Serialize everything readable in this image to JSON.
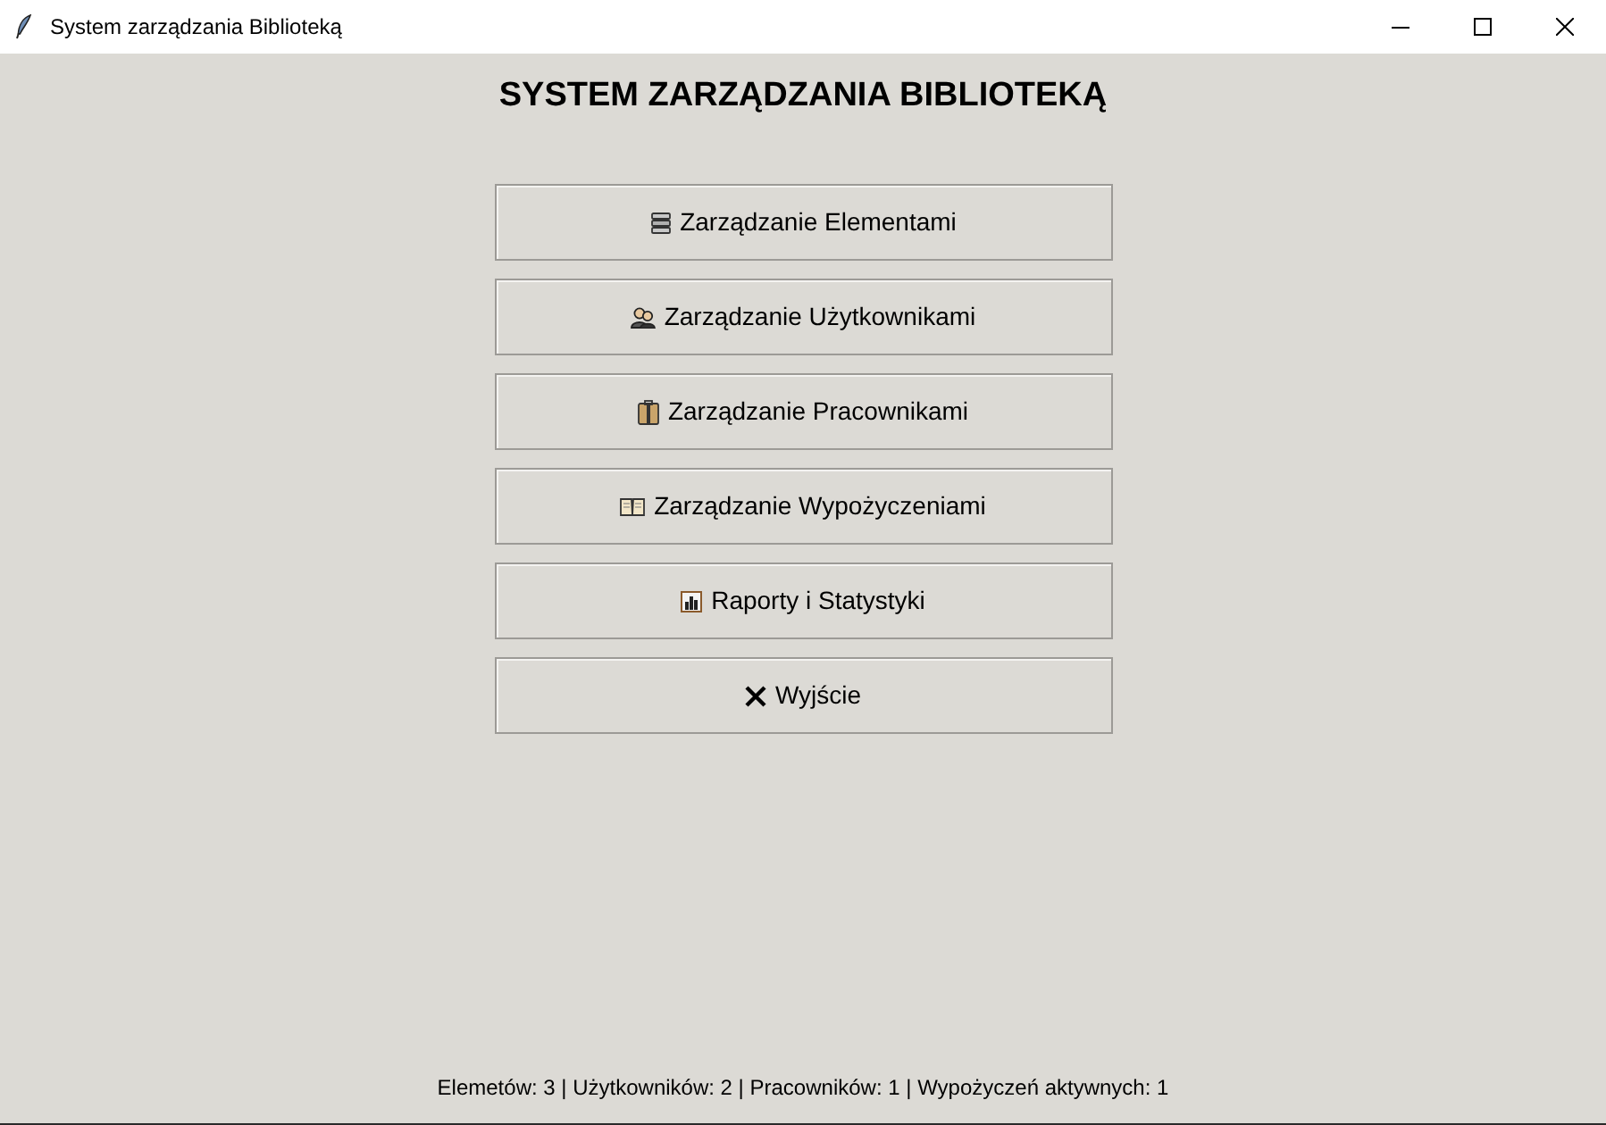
{
  "window": {
    "title": "System zarządzania Biblioteką"
  },
  "heading": "SYSTEM ZARZĄDZANIA BIBLIOTEKĄ",
  "menu_buttons": [
    {
      "label": "Zarządzanie Elementami"
    },
    {
      "label": "Zarządzanie Użytkownikami"
    },
    {
      "label": "Zarządzanie Pracownikami"
    },
    {
      "label": "Zarządzanie Wypożyczeniami"
    },
    {
      "label": "Raporty i Statystyki"
    },
    {
      "label": "Wyjście"
    }
  ],
  "status_bar": "Elemetów: 3 | Użytkowników: 2 | Pracowników: 1 | Wypożyczeń aktywnych: 1"
}
